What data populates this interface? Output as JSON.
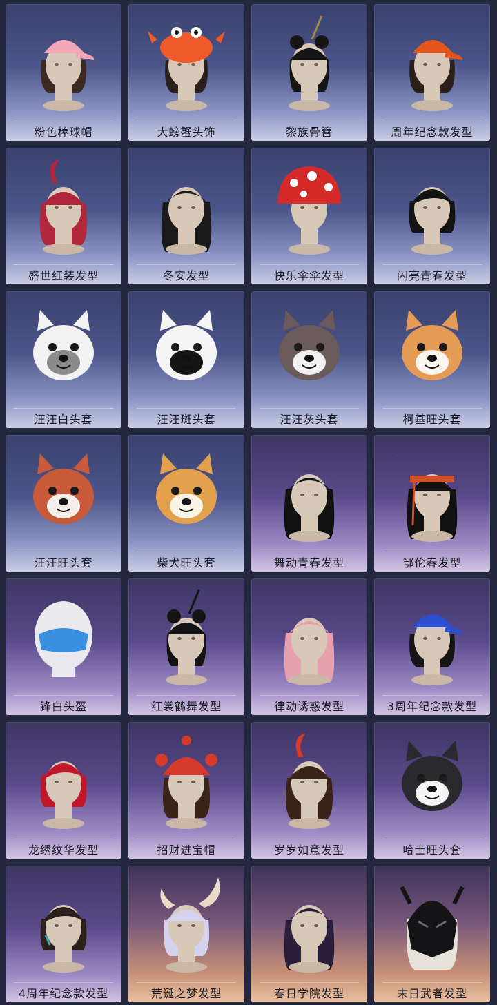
{
  "items": [
    {
      "label": "粉色棒球帽",
      "icon": "pink-baseball-cap-icon",
      "bg": "blue",
      "hair": "#3b2a22",
      "accent": "#f2a8b6",
      "kind": "cap"
    },
    {
      "label": "大螃蟹头饰",
      "icon": "crab-headwear-icon",
      "bg": "blue",
      "hair": "#2a1f1a",
      "accent": "#ef5a2a",
      "kind": "crab"
    },
    {
      "label": "黎族骨簪",
      "icon": "bone-hairpin-icon",
      "bg": "blue",
      "hair": "#151515",
      "accent": "#a08848",
      "kind": "bun"
    },
    {
      "label": "周年纪念款发型",
      "icon": "anniversary-cap-icon",
      "bg": "blue",
      "hair": "#2a1f1a",
      "accent": "#e2561e",
      "kind": "cap"
    },
    {
      "label": "盛世红装发型",
      "icon": "red-ponytail-hair-icon",
      "bg": "blue",
      "hair": "#b0263a",
      "accent": "#b0263a",
      "kind": "ponytail"
    },
    {
      "label": "冬安发型",
      "icon": "long-braid-hair-icon",
      "bg": "blue",
      "hair": "#1a1a1a",
      "accent": "#1a1a1a",
      "kind": "long"
    },
    {
      "label": "快乐伞伞发型",
      "icon": "mushroom-hat-icon",
      "bg": "blue",
      "hair": "#eeeeee",
      "accent": "#d42a2a",
      "kind": "mushroom"
    },
    {
      "label": "闪亮青春发型",
      "icon": "bob-hair-icon",
      "bg": "blue",
      "hair": "#141414",
      "accent": "#141414",
      "kind": "bob"
    },
    {
      "label": "汪汪白头套",
      "icon": "white-dog-mask-icon",
      "bg": "blue",
      "hair": "#f2f2f2",
      "accent": "#8a8a8a",
      "kind": "dog"
    },
    {
      "label": "汪汪斑头套",
      "icon": "spotted-dog-mask-icon",
      "bg": "blue",
      "hair": "#f5f5f5",
      "accent": "#151515",
      "kind": "dog"
    },
    {
      "label": "汪汪灰头套",
      "icon": "gray-dog-mask-icon",
      "bg": "blue",
      "hair": "#6b5a5a",
      "accent": "#f0f0f0",
      "kind": "dog"
    },
    {
      "label": "柯基旺头套",
      "icon": "corgi-mask-icon",
      "bg": "blue",
      "hair": "#e39b55",
      "accent": "#fbf5ee",
      "kind": "dog"
    },
    {
      "label": "汪汪旺头套",
      "icon": "red-dog-mask-icon",
      "bg": "blue",
      "hair": "#c85a3a",
      "accent": "#f6eee8",
      "kind": "dog"
    },
    {
      "label": "柴犬旺头套",
      "icon": "shiba-mask-icon",
      "bg": "blue",
      "hair": "#e3a14e",
      "accent": "#fbf3e6",
      "kind": "dog"
    },
    {
      "label": "舞动青春发型",
      "icon": "long-straight-hair-icon",
      "bg": "violet",
      "hair": "#111111",
      "accent": "#111111",
      "kind": "long"
    },
    {
      "label": "鄂伦春发型",
      "icon": "ethnic-headband-icon",
      "bg": "violet",
      "hair": "#111111",
      "accent": "#d0522a",
      "kind": "band"
    },
    {
      "label": "锋白头盔",
      "icon": "motorcycle-helmet-icon",
      "bg": "violet",
      "hair": "#e9e9ee",
      "accent": "#3a8fe0",
      "kind": "helmet"
    },
    {
      "label": "红裳鹤舞发型",
      "icon": "double-bun-hair-icon",
      "bg": "violet",
      "hair": "#141414",
      "accent": "#141414",
      "kind": "bun"
    },
    {
      "label": "律动诱惑发型",
      "icon": "pink-twintail-hair-icon",
      "bg": "violet",
      "hair": "#e7a0ad",
      "accent": "#e7a0ad",
      "kind": "long"
    },
    {
      "label": "3周年纪念款发型",
      "icon": "anniversary-cap-icon",
      "bg": "violet",
      "hair": "#151515",
      "accent": "#2a4fd0",
      "kind": "cap"
    },
    {
      "label": "龙绣纹华发型",
      "icon": "red-bob-hair-icon",
      "bg": "violet",
      "hair": "#c0182a",
      "accent": "#c0182a",
      "kind": "bob"
    },
    {
      "label": "招财进宝帽",
      "icon": "red-knit-hat-icon",
      "bg": "violet",
      "hair": "#3a2418",
      "accent": "#d53a2a",
      "kind": "beanie"
    },
    {
      "label": "岁岁如意发型",
      "icon": "twin-pigtail-hair-icon",
      "bg": "violet",
      "hair": "#3a2418",
      "accent": "#d53a2a",
      "kind": "ponytail"
    },
    {
      "label": "哈士旺头套",
      "icon": "husky-mask-icon",
      "bg": "violet",
      "hair": "#2a2a2e",
      "accent": "#f4f4f4",
      "kind": "dog"
    },
    {
      "label": "4周年纪念款发型",
      "icon": "wavy-hair-icon",
      "bg": "violet",
      "hair": "#2a1f1a",
      "accent": "#3aa7b8",
      "kind": "bob"
    },
    {
      "label": "荒诞之梦发型",
      "icon": "horned-silver-hair-icon",
      "bg": "dusk",
      "hair": "#d4d2ec",
      "accent": "#e8dcc8",
      "kind": "horns"
    },
    {
      "label": "春日学院发型",
      "icon": "purple-long-hair-icon",
      "bg": "dusk",
      "hair": "#2a1f3a",
      "accent": "#7a45a8",
      "kind": "long"
    },
    {
      "label": "末日武者发型",
      "icon": "armored-mask-icon",
      "bg": "dusk",
      "hair": "#141416",
      "accent": "#6a6a72",
      "kind": "armor"
    }
  ]
}
